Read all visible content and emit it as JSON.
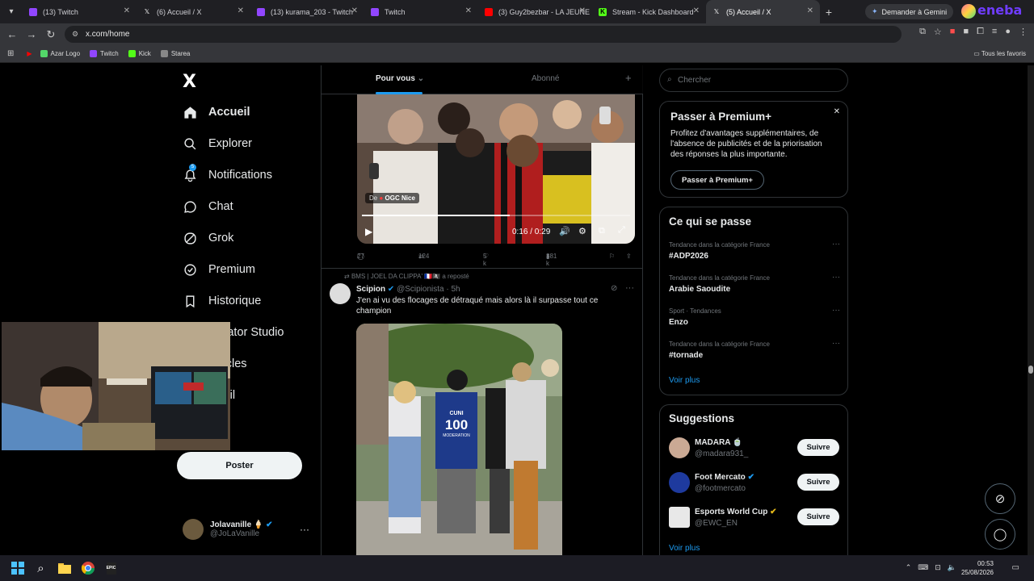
{
  "browser": {
    "tabs": [
      {
        "title": "(13) Twitch",
        "icon": "twitch-icon",
        "color": "#9146ff"
      },
      {
        "title": "(6) Accueil / X",
        "icon": "x-icon",
        "color": "#ffffff"
      },
      {
        "title": "(13) kurama_203 - Twitch",
        "icon": "twitch-icon",
        "color": "#9146ff"
      },
      {
        "title": "Twitch",
        "icon": "twitch-icon",
        "color": "#9146ff"
      },
      {
        "title": "(3) Guy2bezbar - LA JEUNE",
        "icon": "youtube-icon",
        "color": "#ff0000"
      },
      {
        "title": "Stream - Kick Dashboard",
        "icon": "kick-icon",
        "color": "#53fc18"
      },
      {
        "title": "(5) Accueil / X",
        "icon": "x-icon",
        "color": "#ffffff",
        "active": true
      }
    ],
    "gemini_label": "Demander à Gemini",
    "eneba_label": "eneba",
    "url": "x.com/home",
    "bookmarks": [
      {
        "label": "Azar Logo",
        "color": "#53d769"
      },
      {
        "label": "Twitch",
        "color": "#9146ff"
      },
      {
        "label": "Kick",
        "color": "#53fc18"
      },
      {
        "label": "Starea",
        "color": "#888888"
      }
    ],
    "bookmarks_all": "Tous les favoris"
  },
  "sidebar": {
    "logo": "X",
    "items": [
      {
        "label": "Accueil",
        "icon": "home-icon"
      },
      {
        "label": "Explorer",
        "icon": "search-icon"
      },
      {
        "label": "Notifications",
        "icon": "bell-icon",
        "badge": "5"
      },
      {
        "label": "Chat",
        "icon": "chat-icon"
      },
      {
        "label": "Grok",
        "icon": "grok-icon"
      },
      {
        "label": "Premium",
        "icon": "premium-icon"
      },
      {
        "label": "Historique",
        "icon": "bookmark-icon"
      },
      {
        "label": "Creator Studio",
        "icon": "creator-studio-icon"
      },
      {
        "label": "Articles",
        "icon": "articles-icon"
      },
      {
        "label": "Profil",
        "icon": "profile-icon"
      }
    ],
    "post_button": "Poster",
    "user": {
      "name": "Jolavanille 🍦",
      "handle": "@JoLaVanille"
    }
  },
  "feed": {
    "tabs": [
      "Pour vous",
      "Abonné"
    ],
    "video": {
      "source_prefix": "De",
      "source_name": "OGC Nice",
      "time": "0:16 / 0:29",
      "progress": 0.55
    },
    "video_actions": {
      "replies": "27",
      "reposts": "124",
      "likes": "5 k",
      "views": "381 k"
    },
    "tweet": {
      "reposted_by": "BMS | JOEL DA CLIPPA' 🇫🇷🏴‍☠️ a reposté",
      "author": "Scipion",
      "handle": "@Scipionista",
      "time": "5h",
      "text": "J'en ai vu des flocages de détraqué mais alors là il surpasse tout ce champion",
      "jersey_name": "CUNI",
      "jersey_number": "100",
      "jersey_sub": "MODERATION"
    }
  },
  "right": {
    "search_placeholder": "Chercher",
    "premium": {
      "title": "Passer à Premium+",
      "text": "Profitez d'avantages supplémentaires, de l'absence de publicités et de la priorisation des réponses la plus importante.",
      "button": "Passer à Premium+"
    },
    "trends": {
      "title": "Ce qui se passe",
      "items": [
        {
          "meta": "Tendance dans la catégorie France",
          "title": "#ADP2026"
        },
        {
          "meta": "Tendance dans la catégorie France",
          "title": "Arabie Saoudite"
        },
        {
          "meta": "Sport · Tendances",
          "title": "Enzo"
        },
        {
          "meta": "Tendance dans la catégorie France",
          "title": "#tornade"
        }
      ],
      "more": "Voir plus"
    },
    "suggestions": {
      "title": "Suggestions",
      "items": [
        {
          "name": "MADARA 🍵",
          "handle": "@madara931_",
          "follow": "Suivre",
          "avatar_color": "#caa994"
        },
        {
          "name": "Foot Mercato",
          "handle": "@footmercato",
          "follow": "Suivre",
          "avatar_color": "#1e3a9e"
        },
        {
          "name": "Esports World Cup",
          "handle": "@EWC_EN",
          "follow": "Suivre",
          "avatar_color": "#e8e8e8"
        }
      ],
      "more": "Voir plus"
    }
  },
  "taskbar": {
    "time": "00:53",
    "date": "25/08/2026"
  },
  "colors": {
    "accent": "#1d9bf0",
    "background": "#000000",
    "border": "#2f3336",
    "muted": "#71767b"
  }
}
